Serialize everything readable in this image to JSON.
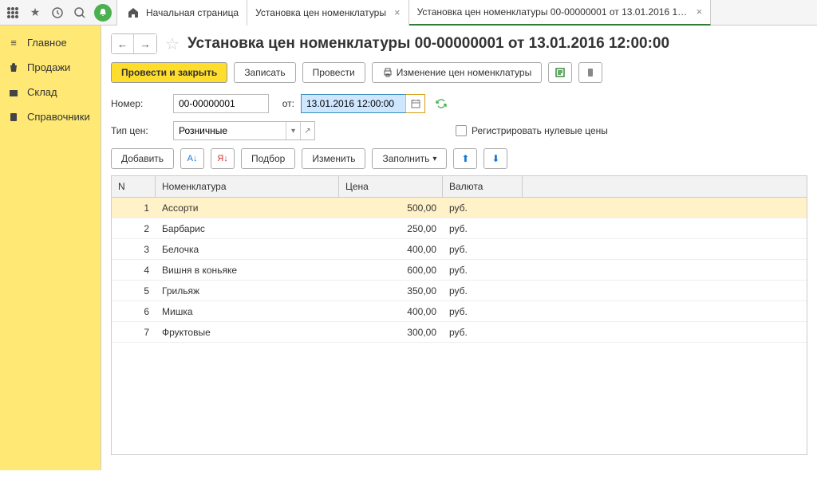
{
  "topbar": {
    "tabs": [
      {
        "label": "Начальная страница"
      },
      {
        "label": "Установка цен номенклатуры"
      },
      {
        "label": "Установка цен номенклатуры 00-00000001 от 13.01.2016 12:00:00",
        "active": true
      }
    ]
  },
  "sidebar": {
    "items": [
      {
        "label": "Главное"
      },
      {
        "label": "Продажи"
      },
      {
        "label": "Склад"
      },
      {
        "label": "Справочники"
      }
    ]
  },
  "header": {
    "title": "Установка цен номенклатуры 00-00000001 от 13.01.2016 12:00:00"
  },
  "toolbar": {
    "post_close": "Провести и закрыть",
    "save": "Записать",
    "post": "Провести",
    "price_change": "Изменение цен номенклатуры"
  },
  "form": {
    "number_label": "Номер:",
    "number_value": "00-00000001",
    "date_label": "от:",
    "date_value": "13.01.2016 12:00:00",
    "pricetype_label": "Тип цен:",
    "pricetype_value": "Розничные",
    "register_zero": "Регистрировать нулевые цены"
  },
  "toolbar2": {
    "add": "Добавить",
    "pick": "Подбор",
    "edit": "Изменить",
    "fill": "Заполнить"
  },
  "table": {
    "headers": {
      "n": "N",
      "nom": "Номенклатура",
      "price": "Цена",
      "cur": "Валюта"
    },
    "rows": [
      {
        "n": "1",
        "nom": "Ассорти",
        "price": "500,00",
        "cur": "руб."
      },
      {
        "n": "2",
        "nom": "Барбарис",
        "price": "250,00",
        "cur": "руб."
      },
      {
        "n": "3",
        "nom": "Белочка",
        "price": "400,00",
        "cur": "руб."
      },
      {
        "n": "4",
        "nom": "Вишня в коньяке",
        "price": "600,00",
        "cur": "руб."
      },
      {
        "n": "5",
        "nom": "Грильяж",
        "price": "350,00",
        "cur": "руб."
      },
      {
        "n": "6",
        "nom": "Мишка",
        "price": "400,00",
        "cur": "руб."
      },
      {
        "n": "7",
        "nom": "Фруктовые",
        "price": "300,00",
        "cur": "руб."
      }
    ]
  }
}
